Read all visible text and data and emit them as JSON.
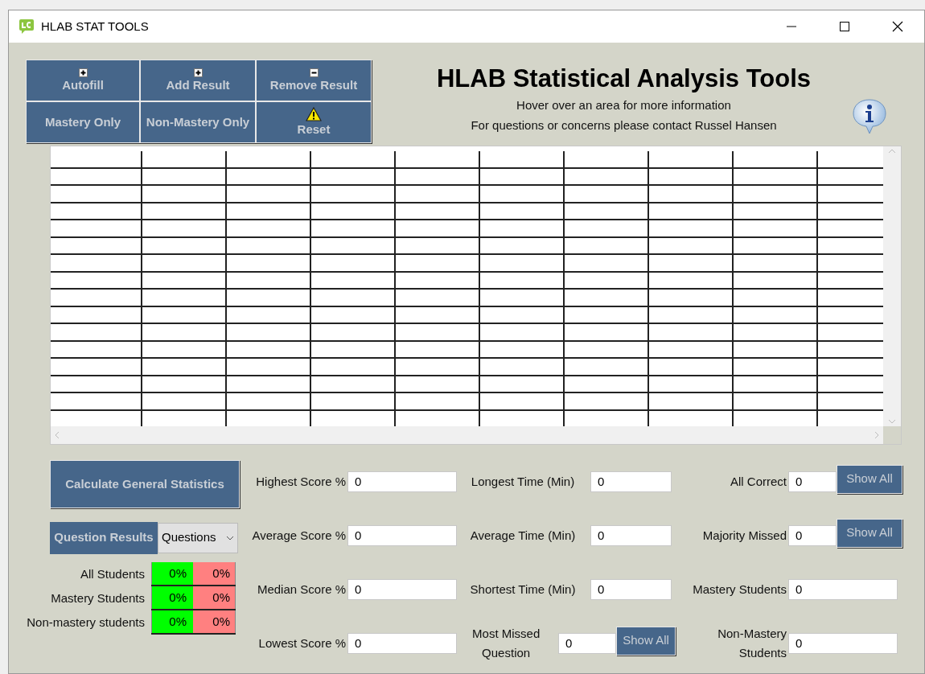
{
  "window": {
    "title": "HLAB STAT TOOLS"
  },
  "toolbar": [
    {
      "label": "Autofill"
    },
    {
      "label": "Add Result"
    },
    {
      "label": "Remove Result"
    },
    {
      "label": "Mastery Only"
    },
    {
      "label": "Non-Mastery Only"
    },
    {
      "label": "Reset"
    }
  ],
  "header": {
    "title": "HLAB Statistical Analysis Tools",
    "lines": [
      "Hover over an area for more information",
      "For questions or concerns please contact Russel Hansen"
    ]
  },
  "left_panel": {
    "calculate_button": "Calculate General Statistics",
    "question_results_button": "Question Results",
    "dropdown": {
      "value": "Questions"
    },
    "breakdown": [
      {
        "label": "All Students",
        "correct": "0%",
        "incorrect": "0%"
      },
      {
        "label": "Mastery Students",
        "correct": "0%",
        "incorrect": "0%"
      },
      {
        "label": "Non-mastery students",
        "correct": "0%",
        "incorrect": "0%"
      }
    ]
  },
  "stat_columns": [
    [
      {
        "kind": "field",
        "label": "Highest Score %",
        "value": "0"
      },
      {
        "kind": "field",
        "label": "Average Score %",
        "value": "0"
      },
      {
        "kind": "field",
        "label": "Median Score %",
        "value": "0"
      },
      {
        "kind": "field",
        "label": "Lowest Score %",
        "value": "0"
      }
    ],
    [
      {
        "kind": "field",
        "label": "Longest Time (Min)",
        "value": "0"
      },
      {
        "kind": "field",
        "label": "Average Time (Min)",
        "value": "0"
      },
      {
        "kind": "field",
        "label": "Shortest Time (Min)",
        "value": "0"
      },
      {
        "kind": "field_button",
        "label": "Most Missed Question",
        "value": "0",
        "button": "Show All"
      }
    ],
    [
      {
        "kind": "field_button",
        "label": "All Correct",
        "value": "0",
        "button": "Show All"
      },
      {
        "kind": "field_button",
        "label": "Majority Missed",
        "value": "0",
        "button": "Show All"
      },
      {
        "kind": "field",
        "label": "Mastery Students",
        "value": "0"
      },
      {
        "kind": "field",
        "label": "Non-Mastery Students",
        "value": "0"
      }
    ]
  ]
}
